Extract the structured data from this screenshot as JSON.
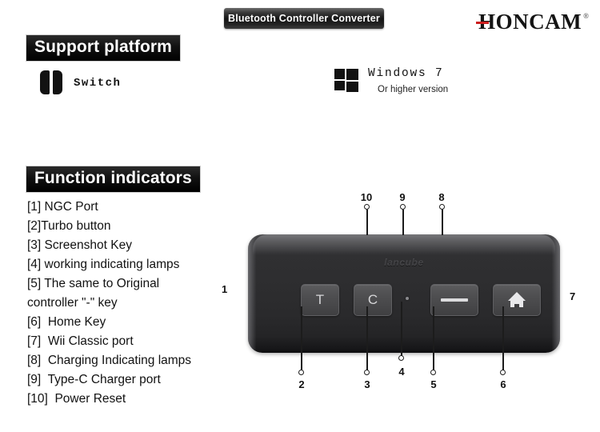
{
  "header": {
    "product_badge": "Bluetooth Controller Converter",
    "brand": {
      "name": "HONCAM",
      "registered_mark": "®"
    }
  },
  "support_platform": {
    "title": "Support platform",
    "platforms": [
      {
        "icon": "nintendo-switch-icon",
        "label": "Switch",
        "sub": ""
      },
      {
        "icon": "windows-logo-icon",
        "label": "Windows 7",
        "sub": "Or higher version"
      }
    ]
  },
  "function_indicators": {
    "title": "Function indicators",
    "items": [
      "[1] NGC Port",
      "[2]Turbo button",
      "[3] Screenshot Key",
      "[4] working indicating lamps",
      "[5] The same to Original",
      "controller \"-\" key",
      "[6]  Home Key",
      "[7]  Wii Classic port",
      "[8]  Charging Indicating lamps",
      "[9]  Type-C Charger port",
      "[10]  Power Reset"
    ]
  },
  "device": {
    "brand_emboss": "lancube",
    "buttons": [
      {
        "name": "turbo-button",
        "glyph": "T"
      },
      {
        "name": "screenshot-button",
        "glyph": "C"
      },
      {
        "name": "minus-button",
        "glyph": "—"
      },
      {
        "name": "home-button",
        "glyph": "home"
      }
    ],
    "callouts": {
      "top": [
        "10",
        "9",
        "8"
      ],
      "bottom": [
        "2",
        "3",
        "4",
        "5",
        "6"
      ],
      "left": "1",
      "right": "7"
    }
  },
  "colors": {
    "accent_red": "#cc1f1f",
    "header_black": "#000000",
    "device_body": "#2d2d2f",
    "device_button": "#4f4f51",
    "page_background": "#ffffff"
  }
}
